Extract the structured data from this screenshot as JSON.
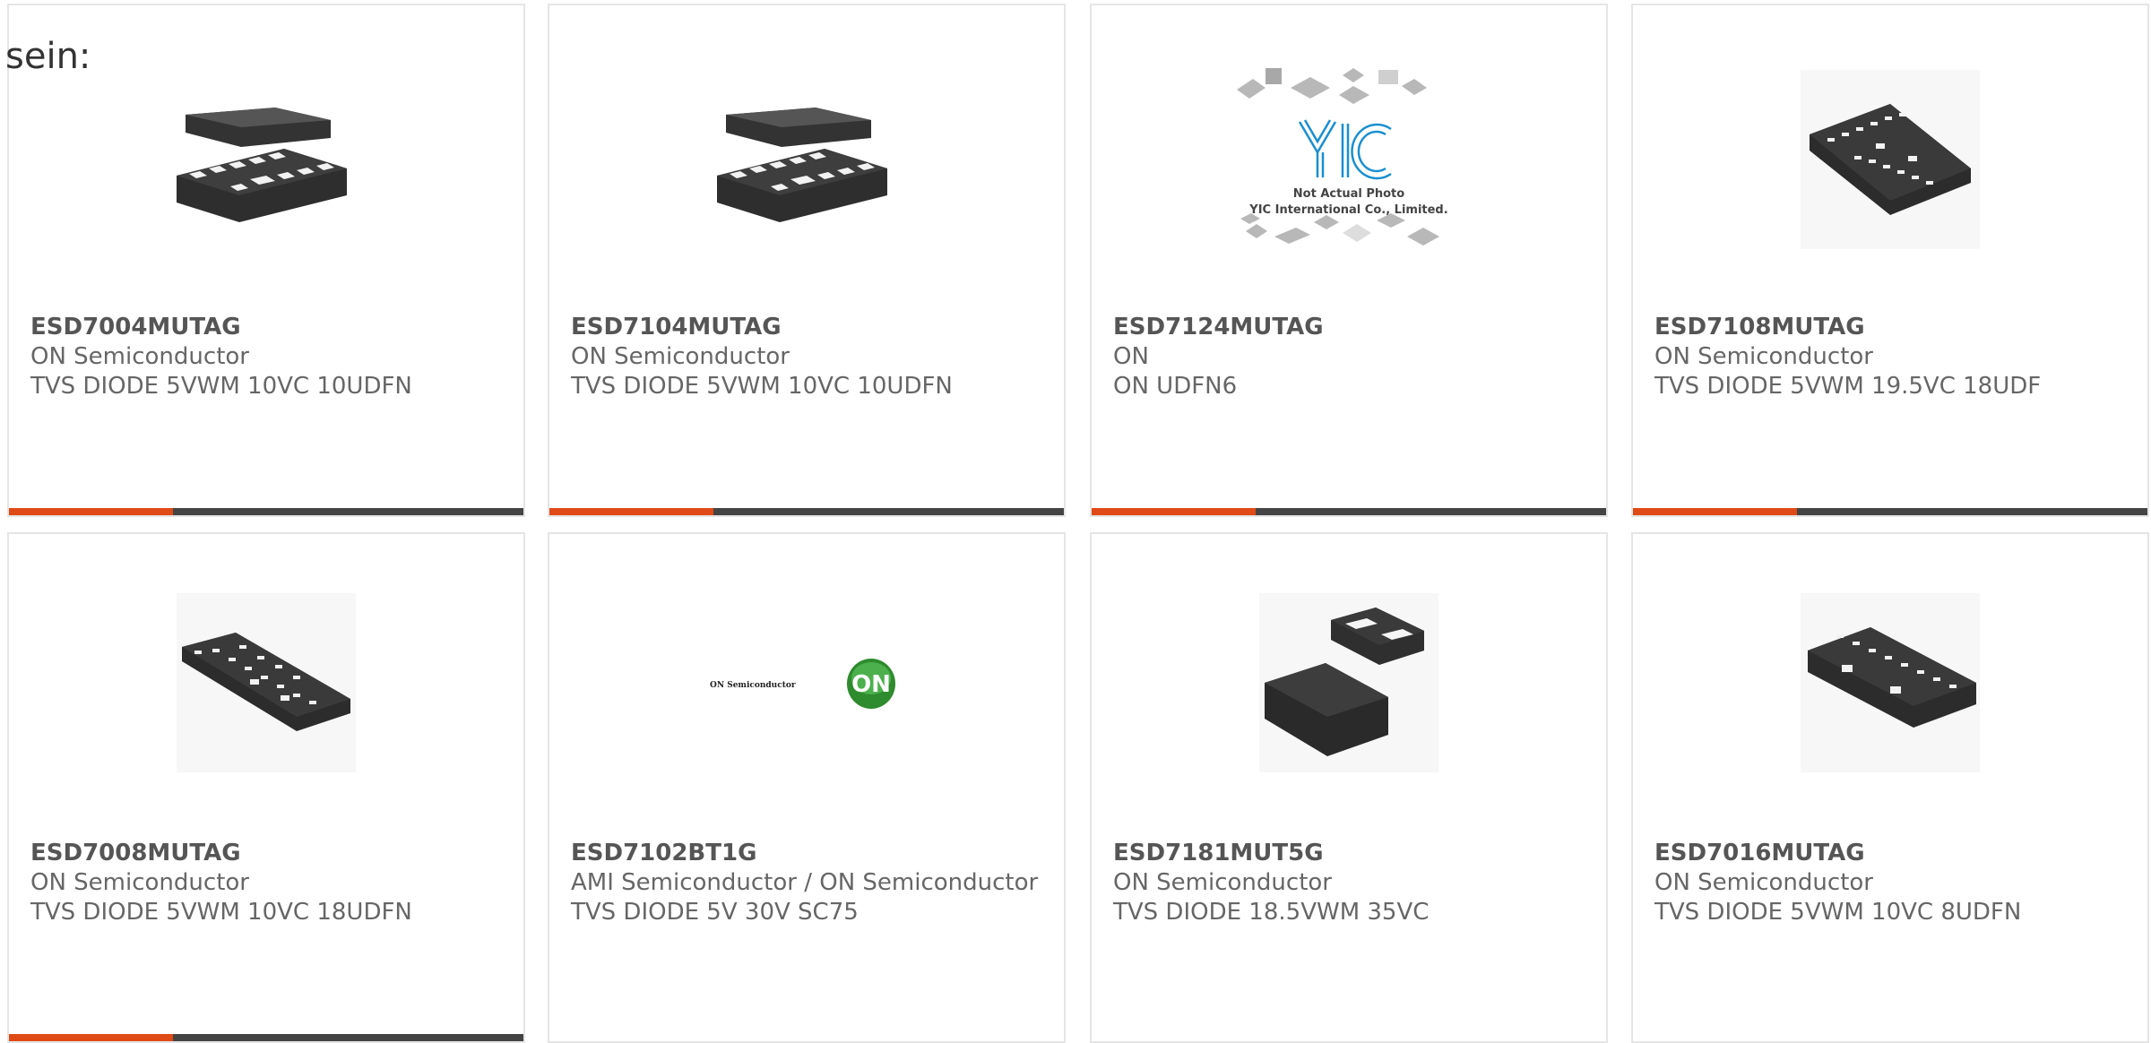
{
  "heading": "sein:",
  "products": [
    {
      "part": "ESD7004MUTAG",
      "manufacturer": "ON Semiconductor",
      "description": "TVS DIODE 5VWM 10VC 10UDFN",
      "image": "udfn10-chip-image"
    },
    {
      "part": "ESD7104MUTAG",
      "manufacturer": "ON Semiconductor",
      "description": "TVS DIODE 5VWM 10VC 10UDFN",
      "image": "udfn10-chip-image"
    },
    {
      "part": "ESD7124MUTAG",
      "manufacturer": "ON",
      "description": "ON UDFN6",
      "image": "placeholder-image",
      "placeholder_lines": [
        "Not Actual Photo",
        "YIC International Co., Limited."
      ],
      "placeholder_logo": "YIC"
    },
    {
      "part": "ESD7108MUTAG",
      "manufacturer": "ON Semiconductor",
      "description": "TVS DIODE 5VWM 19.5VC 18UDF",
      "image": "udfn18-chip-image"
    },
    {
      "part": "ESD7008MUTAG",
      "manufacturer": "ON Semiconductor",
      "description": "TVS DIODE 5VWM 10VC 18UDFN",
      "image": "udfn18-chip-image"
    },
    {
      "part": "ESD7102BT1G",
      "manufacturer": "AMI Semiconductor / ON Semiconductor",
      "description": "TVS DIODE 5V 30V SC75",
      "image": "on-logo-image",
      "logo_text": "ON Semiconductor",
      "logo_mark": "ON"
    },
    {
      "part": "ESD7181MUT5G",
      "manufacturer": "ON Semiconductor",
      "description": "TVS DIODE 18.5VWM 35VC",
      "image": "two-pad-chip-image"
    },
    {
      "part": "ESD7016MUTAG",
      "manufacturer": "ON Semiconductor",
      "description": "TVS DIODE 5VWM 10VC 8UDFN",
      "image": "udfn8-chip-image"
    }
  ],
  "colors": {
    "accent": "#e04a16",
    "bar": "#444444",
    "chip": "#3a3a3a"
  }
}
